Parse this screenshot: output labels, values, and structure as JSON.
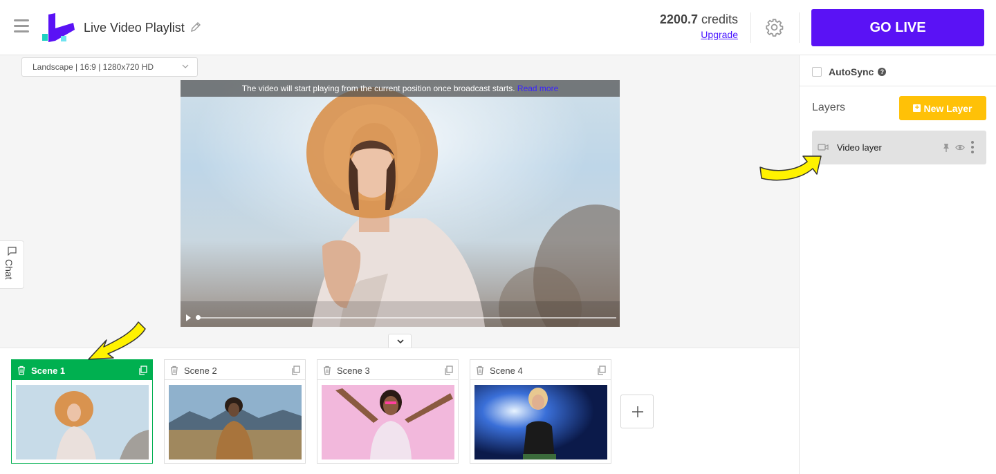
{
  "header": {
    "title": "Live Video Playlist",
    "credits_value": "2200.7",
    "credits_unit": "credits",
    "upgrade_label": "Upgrade",
    "go_live_label": "GO LIVE"
  },
  "canvas": {
    "resolution": "Landscape | 16:9 | 1280x720 HD",
    "banner_text": "The video will start playing from the current position once broadcast starts.",
    "read_more_label": "Read more",
    "chat_label": "Chat"
  },
  "sidebar": {
    "autosync_label": "AutoSync",
    "layers_title": "Layers",
    "new_layer_label": "New Layer",
    "layers": [
      {
        "name": "Video layer"
      }
    ]
  },
  "scenes": [
    {
      "name": "Scene 1",
      "active": true
    },
    {
      "name": "Scene 2",
      "active": false
    },
    {
      "name": "Scene 3",
      "active": false
    },
    {
      "name": "Scene 4",
      "active": false
    }
  ],
  "colors": {
    "go_live": "#5a12f5",
    "new_layer": "#ffc107",
    "active_scene": "#00b050",
    "annotation_arrow": "#fff200"
  },
  "icons": [
    "menu-icon",
    "edit-icon",
    "gear-icon",
    "help-icon",
    "plus-icon",
    "camera-icon",
    "pin-icon",
    "eye-icon",
    "kebab-icon",
    "trash-icon",
    "copy-icon",
    "chevron-down-icon",
    "play-icon",
    "chat-icon"
  ]
}
